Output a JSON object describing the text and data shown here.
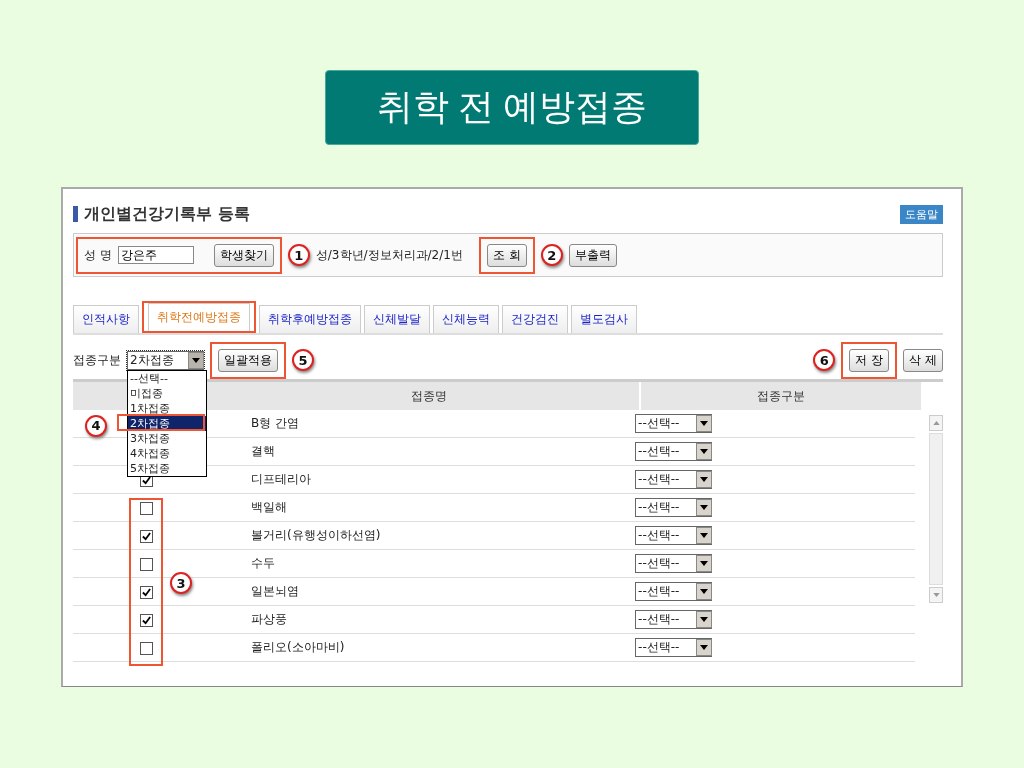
{
  "slide_title": "취학 전 예방접종",
  "page_title": "개인별건강기록부 등록",
  "help_button": "도움말",
  "search": {
    "name_label": "성 명",
    "name_value": "강은주",
    "find_button": "학생찾기",
    "student_info": "성/3학년/정보처리과/2/1번",
    "query_button": "조 회",
    "print_button": "부출력"
  },
  "tabs": [
    {
      "label": "인적사항",
      "selected": false
    },
    {
      "label": "취학전예방접종",
      "selected": true
    },
    {
      "label": "취학후예방접종",
      "selected": false
    },
    {
      "label": "신체발달",
      "selected": false
    },
    {
      "label": "신체능력",
      "selected": false
    },
    {
      "label": "건강검진",
      "selected": false
    },
    {
      "label": "별도검사",
      "selected": false
    }
  ],
  "toolbar": {
    "label": "접종구분",
    "select_value": "2차접종",
    "apply_button": "일괄적용",
    "save_button": "저 장",
    "delete_button": "삭 제"
  },
  "dropdown": {
    "expanded": true,
    "options": [
      {
        "label": "--선택--",
        "selected": false
      },
      {
        "label": "미접종",
        "selected": false
      },
      {
        "label": "1차접종",
        "selected": false
      },
      {
        "label": "2차접종",
        "selected": true
      },
      {
        "label": "3차접종",
        "selected": false
      },
      {
        "label": "4차접종",
        "selected": false
      },
      {
        "label": "5차접종",
        "selected": false
      }
    ]
  },
  "table": {
    "columns": [
      "접종명",
      "접종구분"
    ],
    "rows": [
      {
        "name": "B형 간염",
        "type": "--선택--"
      },
      {
        "name": "결핵",
        "type": "--선택--"
      },
      {
        "name": "디프테리아",
        "type": "--선택--",
        "checked": true
      },
      {
        "name": "백일해",
        "type": "--선택--",
        "checked": false
      },
      {
        "name": "볼거리(유행성이하선염)",
        "type": "--선택--",
        "checked": true
      },
      {
        "name": "수두",
        "type": "--선택--",
        "checked": false
      },
      {
        "name": "일본뇌염",
        "type": "--선택--",
        "checked": true
      },
      {
        "name": "파상풍",
        "type": "--선택--",
        "checked": true
      },
      {
        "name": "폴리오(소아마비)",
        "type": "--선택--",
        "checked": false
      }
    ]
  },
  "callouts": [
    "1",
    "2",
    "3",
    "4",
    "5",
    "6"
  ]
}
